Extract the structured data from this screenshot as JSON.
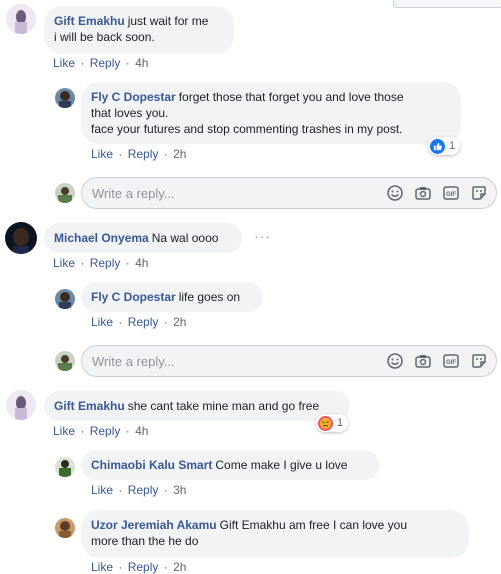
{
  "top_button": "",
  "actions": {
    "like": "Like",
    "reply": "Reply",
    "sep": "·"
  },
  "comments": [
    {
      "author": "Gift Emakhu",
      "text_line1": "just wait for me",
      "text_line2": "i will be back soon.",
      "time": "4h"
    },
    {
      "author": "Fly C Dopestar",
      "text_line1": "forget those that forget you and love those",
      "text_line2": "that loves you.",
      "text_line3": "face your futures and stop commenting trashes in my post.",
      "time": "2h",
      "reaction_count": "1"
    },
    {
      "author": "Michael Onyema",
      "text": "Na wal oooo",
      "time": "4h",
      "more": "···"
    },
    {
      "author": "Fly C Dopestar",
      "text": "life goes on",
      "time": "2h"
    },
    {
      "author": "Gift Emakhu",
      "text": "she cant take mine man and go free",
      "time": "4h",
      "reaction_count": "1"
    },
    {
      "author": "Chimaobi Kalu Smart",
      "text": "Come make I give u love",
      "time": "3h"
    },
    {
      "author": "Uzor Jeremiah Akamu",
      "text_line1": "Gift Emakhu am free I can love you",
      "text_line2": "more than the he do",
      "time": "2h"
    }
  ],
  "reply_box": {
    "placeholder": "Write a reply..."
  },
  "icons": {
    "emoji": "emoji-icon",
    "camera": "camera-icon",
    "gif": "gif-icon",
    "sticker": "sticker-icon"
  },
  "colors": {
    "link": "#385898",
    "bubble": "#f2f3f5",
    "like_blue": "#1877f2",
    "angry": "#f25268"
  }
}
